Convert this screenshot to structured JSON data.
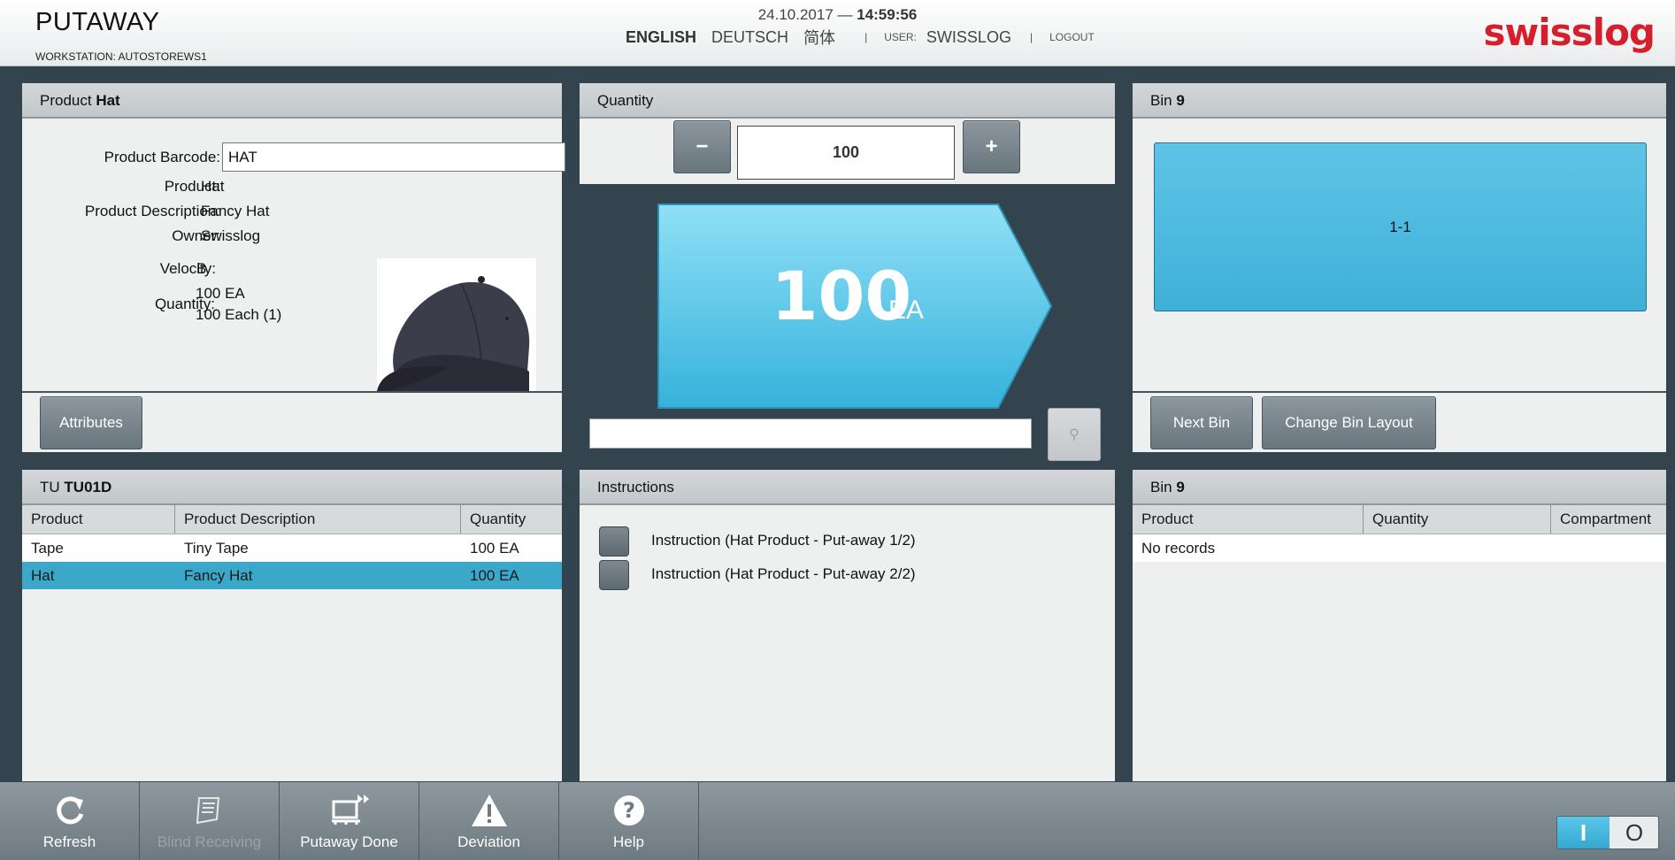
{
  "header": {
    "title": "PUTAWAY",
    "workstation": "WORKSTATION: AUTOSTOREWS1",
    "date": "24.10.2017 —",
    "time": "14:59:56",
    "languages": [
      "ENGLISH",
      "DEUTSCH",
      "简体"
    ],
    "user_label": "USER:",
    "user_name": "SWISSLOG",
    "logout": "LOGOUT",
    "logo_text": "swisslog",
    "brand_color": "#d61f2c"
  },
  "product_panel": {
    "title_prefix": "Product",
    "title_name": "Hat",
    "barcode_label": "Product Barcode:",
    "barcode_value": "HAT",
    "product_label": "Product:",
    "product_value": "Hat",
    "description_label": "Product Description:",
    "description_value": "Fancy Hat",
    "owner_label": "Owner:",
    "owner_value": "Swisslog",
    "velocity_label": "Velocity:",
    "velocity_value": "B",
    "quantity_label": "Quantity:",
    "quantity_value_1": "100 EA",
    "quantity_value_2": "100 Each (1)",
    "attributes_button": "Attributes"
  },
  "quantity_panel": {
    "title": "Quantity",
    "minus": "−",
    "plus": "+",
    "value": "100",
    "big_value": "100",
    "big_unit": "EA",
    "accent_color": "#3fb8e0"
  },
  "bin_panel": {
    "title_prefix": "Bin",
    "title_number": "9",
    "compartment": "1-1",
    "next_bin": "Next Bin",
    "change_layout": "Change Bin Layout"
  },
  "tu_panel": {
    "title_prefix": "TU",
    "title_id": "TU01D",
    "columns": [
      "Product",
      "Product Description",
      "Quantity"
    ],
    "rows": [
      {
        "product": "Tape",
        "description": "Tiny Tape",
        "quantity": "100 EA",
        "selected": false
      },
      {
        "product": "Hat",
        "description": "Fancy Hat",
        "quantity": "100 EA",
        "selected": true
      }
    ]
  },
  "instructions_panel": {
    "title": "Instructions",
    "items": [
      "Instruction (Hat Product - Put-away 1/2)",
      "Instruction (Hat Product - Put-away 2/2)"
    ]
  },
  "bin_contents_panel": {
    "title_prefix": "Bin",
    "title_number": "9",
    "columns": [
      "Product",
      "Quantity",
      "Compartment"
    ],
    "empty_text": "No records"
  },
  "toolbar": {
    "items": [
      {
        "label": "Refresh",
        "icon": "refresh-icon",
        "enabled": true
      },
      {
        "label": "Blind Receiving",
        "icon": "receipt-icon",
        "enabled": false
      },
      {
        "label": "Putaway Done",
        "icon": "pallet-forward-icon",
        "enabled": true
      },
      {
        "label": "Deviation",
        "icon": "warning-icon",
        "enabled": true
      },
      {
        "label": "Help",
        "icon": "help-icon",
        "enabled": true
      }
    ],
    "toggle_on": "I",
    "toggle_off": "O"
  }
}
